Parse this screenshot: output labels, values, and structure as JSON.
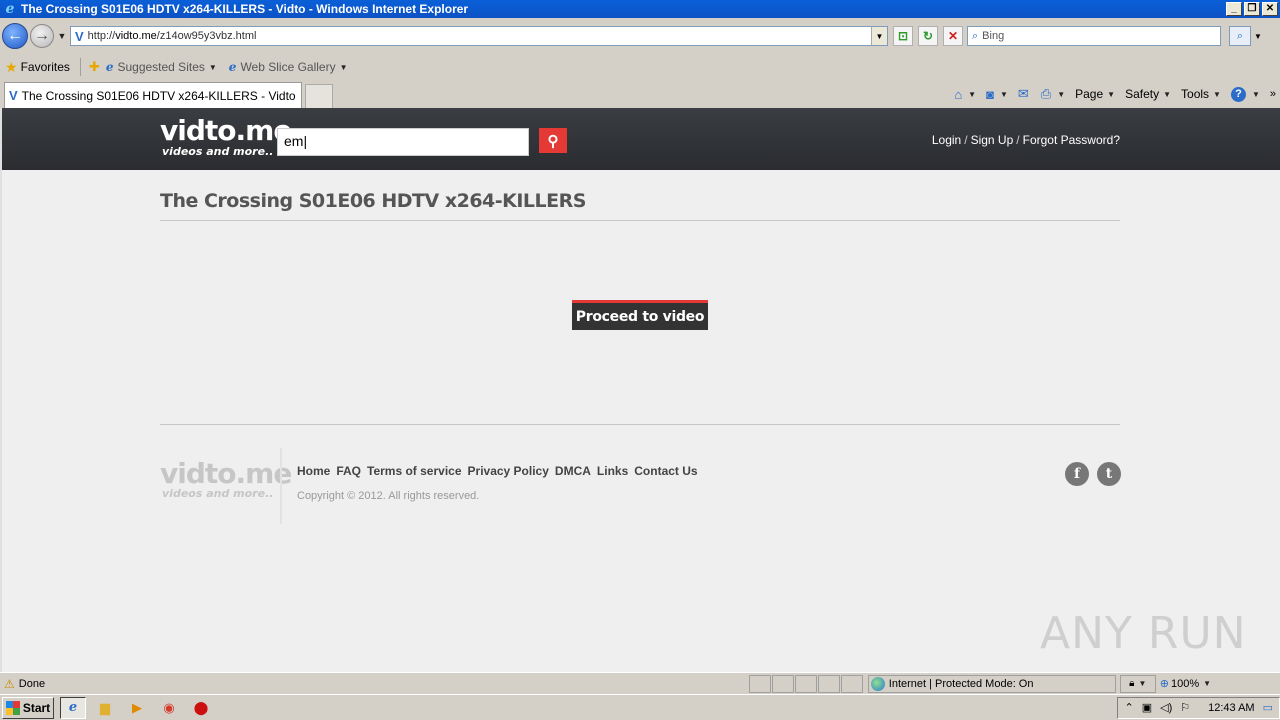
{
  "window": {
    "title": "The Crossing S01E06 HDTV x264-KILLERS - Vidto - Windows Internet Explorer"
  },
  "address": {
    "url_prefix": "http://",
    "url_domain": "vidto.me",
    "url_path": "/z14ow95y3vbz.html"
  },
  "search_bar": {
    "placeholder": "Bing"
  },
  "favorites": {
    "label": "Favorites",
    "items": [
      "Suggested Sites",
      "Web Slice Gallery"
    ]
  },
  "tab": {
    "label": "The Crossing S01E06 HDTV x264-KILLERS - Vidto"
  },
  "commands": {
    "page": "Page",
    "safety": "Safety",
    "tools": "Tools"
  },
  "site": {
    "logo": "vidto.me",
    "tagline": "videos and more..",
    "search_value": "em",
    "login": "Login",
    "signup": "Sign Up",
    "forgot": "Forgot Password?",
    "page_title": "The Crossing S01E06 HDTV x264-KILLERS",
    "proceed_label": "Proceed to video",
    "footer_links": [
      "Home",
      "FAQ",
      "Terms of service",
      "Privacy Policy",
      "DMCA",
      "Links",
      "Contact Us"
    ],
    "copyright": "Copyright © 2012. All rights reserved.",
    "social": [
      "f",
      "t"
    ]
  },
  "status": {
    "text": "Done",
    "zone": "Internet | Protected Mode: On",
    "zoom": "100%"
  },
  "taskbar": {
    "start": "Start",
    "clock": "12:43 AM"
  },
  "watermark": "ANY RUN",
  "colors": {
    "accent_red": "#e53935",
    "header_dark": "#2a2c30"
  }
}
